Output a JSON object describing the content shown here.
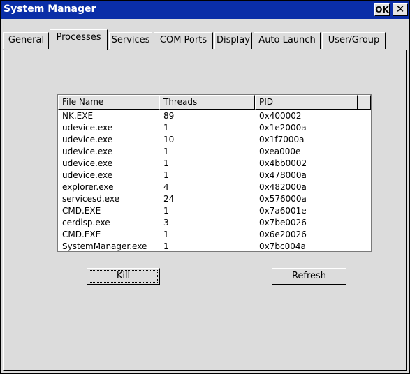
{
  "window": {
    "title": "System Manager",
    "ok_label": "OK",
    "close_glyph": "✕"
  },
  "tabs": [
    {
      "label": "General"
    },
    {
      "label": "Processes",
      "active": true
    },
    {
      "label": "Services"
    },
    {
      "label": "COM Ports"
    },
    {
      "label": "Display"
    },
    {
      "label": "Auto Launch"
    },
    {
      "label": "User/Group"
    }
  ],
  "processes": {
    "columns": [
      "File Name",
      "Threads",
      "PID"
    ],
    "rows": [
      [
        "NK.EXE",
        "89",
        "0x400002"
      ],
      [
        "udevice.exe",
        "1",
        "0x1e2000a"
      ],
      [
        "udevice.exe",
        "10",
        "0x1f7000a"
      ],
      [
        "udevice.exe",
        "1",
        "0xea000e"
      ],
      [
        "udevice.exe",
        "1",
        "0x4bb0002"
      ],
      [
        "udevice.exe",
        "1",
        "0x478000a"
      ],
      [
        "explorer.exe",
        "4",
        "0x482000a"
      ],
      [
        "servicesd.exe",
        "24",
        "0x576000a"
      ],
      [
        "CMD.EXE",
        "1",
        "0x7a6001e"
      ],
      [
        "cerdisp.exe",
        "3",
        "0x7be0026"
      ],
      [
        "CMD.EXE",
        "1",
        "0x6e20026"
      ],
      [
        "SystemManager.exe",
        "1",
        "0x7bc004a"
      ]
    ]
  },
  "buttons": {
    "kill_label": "Kill",
    "refresh_label": "Refresh"
  },
  "colors": {
    "titlebar": "#0a2ea8",
    "face": "#dcdcdc"
  }
}
